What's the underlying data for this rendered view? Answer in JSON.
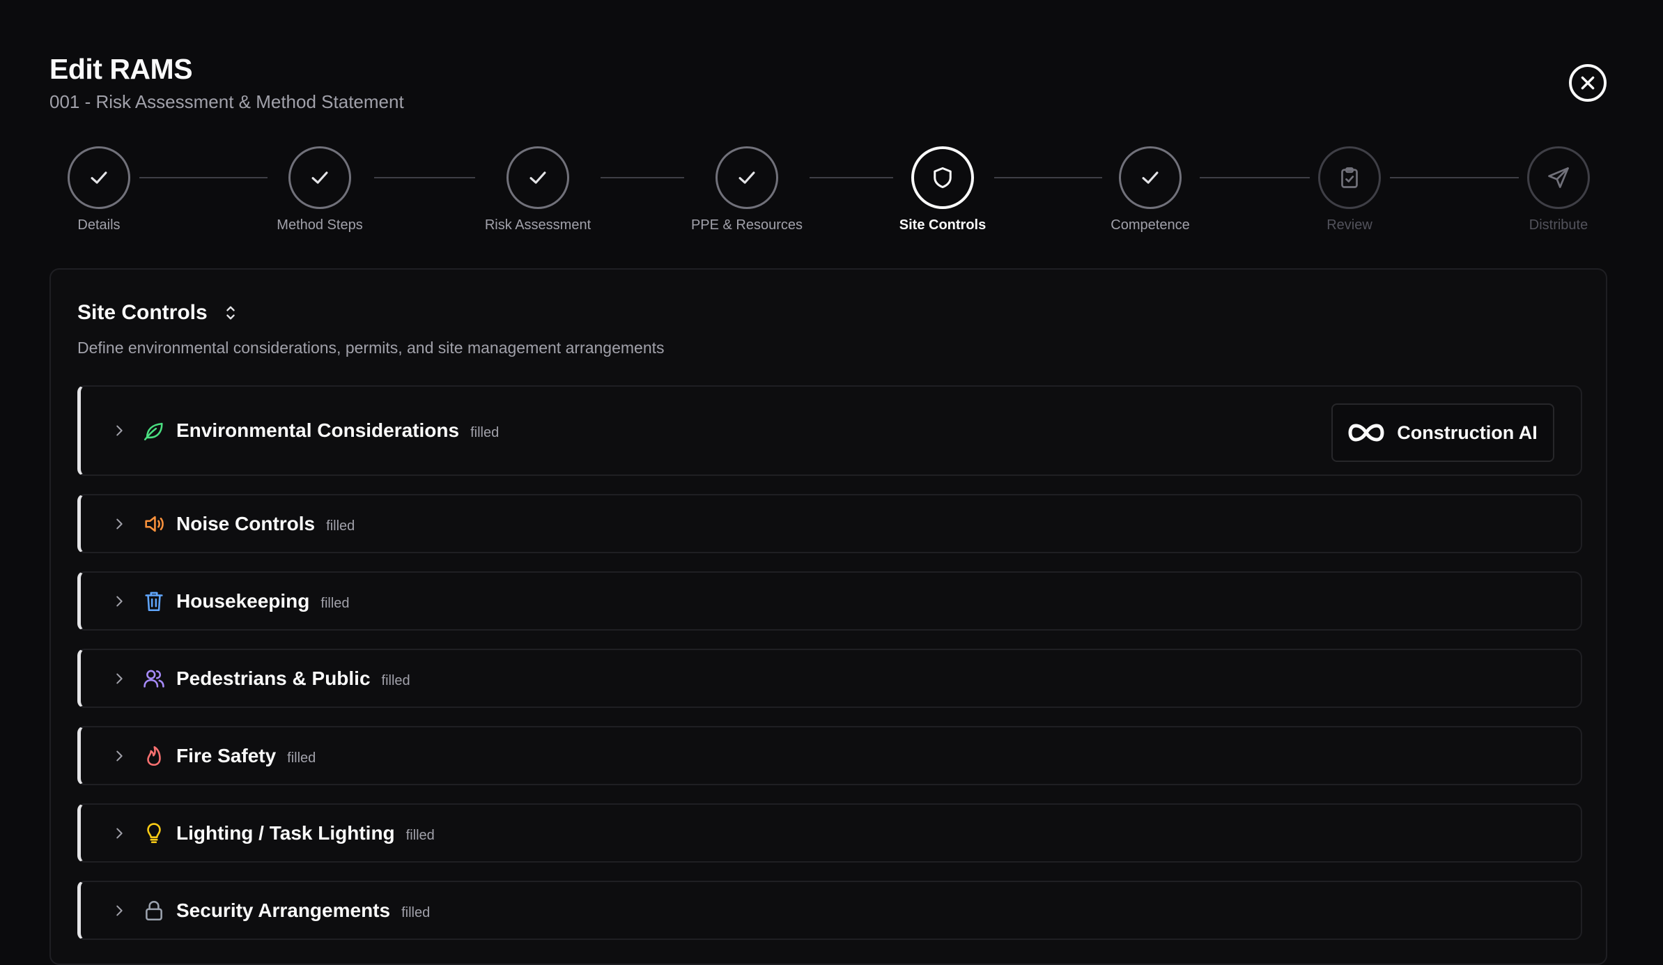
{
  "header": {
    "title": "Edit RAMS",
    "subtitle": "001 - Risk Assessment & Method Statement"
  },
  "stepper": {
    "steps": [
      {
        "label": "Details",
        "state": "complete"
      },
      {
        "label": "Method Steps",
        "state": "complete"
      },
      {
        "label": "Risk Assessment",
        "state": "complete"
      },
      {
        "label": "PPE & Resources",
        "state": "complete"
      },
      {
        "label": "Site Controls",
        "state": "active"
      },
      {
        "label": "Competence",
        "state": "complete"
      },
      {
        "label": "Review",
        "state": "pending"
      },
      {
        "label": "Distribute",
        "state": "pending"
      }
    ]
  },
  "panel": {
    "title": "Site Controls",
    "description": "Define environmental considerations, permits, and site management arrangements",
    "ai_button_label": "Construction AI",
    "sections": [
      {
        "title": "Environmental Considerations",
        "status": "filled",
        "icon": "leaf-icon",
        "color": "#4ade80"
      },
      {
        "title": "Noise Controls",
        "status": "filled",
        "icon": "speaker-icon",
        "color": "#fb923c"
      },
      {
        "title": "Housekeeping",
        "status": "filled",
        "icon": "trash-icon",
        "color": "#60a5fa"
      },
      {
        "title": "Pedestrians & Public",
        "status": "filled",
        "icon": "users-icon",
        "color": "#a78bfa"
      },
      {
        "title": "Fire Safety",
        "status": "filled",
        "icon": "flame-icon",
        "color": "#f87171"
      },
      {
        "title": "Lighting / Task Lighting",
        "status": "filled",
        "icon": "lightbulb-icon",
        "color": "#facc15"
      },
      {
        "title": "Security Arrangements",
        "status": "filled",
        "icon": "lock-icon",
        "color": "#9ca3af"
      }
    ]
  }
}
